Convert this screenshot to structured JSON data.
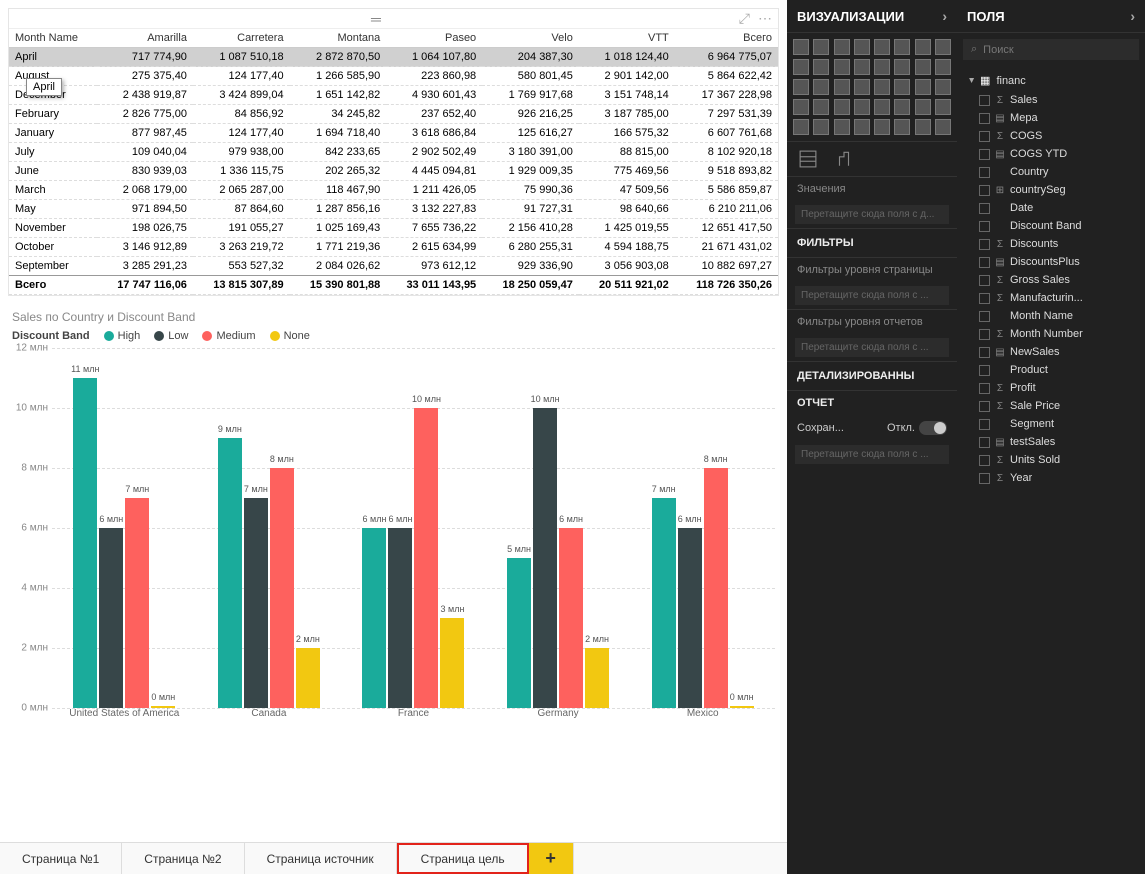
{
  "table": {
    "columns": [
      "Month Name",
      "Amarilla",
      "Carretera",
      "Montana",
      "Paseo",
      "Velo",
      "VTT",
      "Всего"
    ],
    "rows": [
      {
        "highlight": true,
        "cells": [
          "April",
          "717 774,90",
          "1 087 510,18",
          "2 872 870,50",
          "1 064 107,80",
          "204 387,30",
          "1 018 124,40",
          "6 964 775,07"
        ]
      },
      {
        "cells": [
          "August",
          "275 375,40",
          "124 177,40",
          "1 266 585,90",
          "223 860,98",
          "580 801,45",
          "2 901 142,00",
          "5 864 622,42"
        ]
      },
      {
        "cells": [
          "December",
          "2 438 919,87",
          "3 424 899,04",
          "1 651 142,82",
          "4 930 601,43",
          "1 769 917,68",
          "3 151 748,14",
          "17 367 228,98"
        ]
      },
      {
        "cells": [
          "February",
          "2 826 775,00",
          "84 856,92",
          "34 245,82",
          "237 652,40",
          "926 216,25",
          "3 187 785,00",
          "7 297 531,39"
        ]
      },
      {
        "cells": [
          "January",
          "877 987,45",
          "124 177,40",
          "1 694 718,40",
          "3 618 686,84",
          "125 616,27",
          "166 575,32",
          "6 607 761,68"
        ]
      },
      {
        "cells": [
          "July",
          "109 040,04",
          "979 938,00",
          "842 233,65",
          "2 902 502,49",
          "3 180 391,00",
          "88 815,00",
          "8 102 920,18"
        ]
      },
      {
        "cells": [
          "June",
          "830 939,03",
          "1 336 115,75",
          "202 265,32",
          "4 445 094,81",
          "1 929 009,35",
          "775 469,56",
          "9 518 893,82"
        ]
      },
      {
        "cells": [
          "March",
          "2 068 179,00",
          "2 065 287,00",
          "118 467,90",
          "1 211 426,05",
          "75 990,36",
          "47 509,56",
          "5 586 859,87"
        ]
      },
      {
        "cells": [
          "May",
          "971 894,50",
          "87 864,60",
          "1 287 856,16",
          "3 132 227,83",
          "91 727,31",
          "98 640,66",
          "6 210 211,06"
        ]
      },
      {
        "cells": [
          "November",
          "198 026,75",
          "191 055,27",
          "1 025 169,43",
          "7 655 736,22",
          "2 156 410,28",
          "1 425 019,55",
          "12 651 417,50"
        ]
      },
      {
        "cells": [
          "October",
          "3 146 912,89",
          "3 263 219,72",
          "1 771 219,36",
          "2 615 634,99",
          "6 280 255,31",
          "4 594 188,75",
          "21 671 431,02"
        ]
      },
      {
        "cells": [
          "September",
          "3 285 291,23",
          "553 527,32",
          "2 084 026,62",
          "973 612,12",
          "929 336,90",
          "3 056 903,08",
          "10 882 697,27"
        ]
      }
    ],
    "total": {
      "cells": [
        "Всего",
        "17 747 116,06",
        "13 815 307,89",
        "15 390 801,88",
        "33 011 143,95",
        "18 250 059,47",
        "20 511 921,02",
        "118 726 350,26"
      ]
    },
    "tooltip": "April"
  },
  "chart_data": {
    "type": "bar",
    "title": "Sales по Country и Discount Band",
    "legend_label": "Discount Band",
    "ylabel": "",
    "ylim": [
      0,
      12
    ],
    "y_unit": "млн",
    "y_ticks": [
      0,
      2,
      4,
      6,
      8,
      10,
      12
    ],
    "categories": [
      "United States of America",
      "Canada",
      "France",
      "Germany",
      "Mexico"
    ],
    "series": [
      {
        "name": "High",
        "color": "#1aab9b",
        "values": [
          11,
          9,
          6,
          5,
          7
        ]
      },
      {
        "name": "Low",
        "color": "#374649",
        "values": [
          6,
          7,
          6,
          10,
          6
        ]
      },
      {
        "name": "Medium",
        "color": "#fe615e",
        "values": [
          7,
          8,
          10,
          6,
          8
        ]
      },
      {
        "name": "None",
        "color": "#f2c811",
        "values": [
          0,
          2,
          3,
          2,
          0
        ]
      }
    ],
    "bar_labels": [
      [
        "11 млн",
        "6 млн",
        "7 млн",
        "0 млн"
      ],
      [
        "9 млн",
        "7 млн",
        "8 млн",
        "2 млн"
      ],
      [
        "6 млн",
        "6 млн",
        "10 млн",
        "3 млн"
      ],
      [
        "5 млн",
        "10 млн",
        "6 млн",
        "2 млн"
      ],
      [
        "7 млн",
        "6 млн",
        "8 млн",
        "0 млн"
      ]
    ]
  },
  "tabs": [
    "Страница №1",
    "Страница №2",
    "Страница источник",
    "Страница цель"
  ],
  "active_tab_index": 3,
  "viz_panel": {
    "title": "ВИЗУАЛИЗАЦИИ",
    "values_label": "Значения",
    "drop_here": "Перетащите сюда поля с д...",
    "filters_title": "ФИЛЬТРЫ",
    "filter_page": "Фильтры уровня страницы",
    "filter_report": "Фильтры уровня отчетов",
    "drop_fields": "Перетащите сюда поля с ...",
    "drill_title": "ДЕТАЛИЗИРОВАННЫ",
    "report_label": "ОТЧЕТ",
    "keep_label": "Сохран...",
    "off_label": "Откл."
  },
  "fields_panel": {
    "title": "ПОЛЯ",
    "search_placeholder": "Поиск",
    "table_name": "financ",
    "fields": [
      {
        "name": "Sales",
        "sigma": true
      },
      {
        "name": "Мера",
        "sigma": false,
        "icon": "measure"
      },
      {
        "name": "COGS",
        "sigma": true
      },
      {
        "name": "COGS YTD",
        "sigma": false,
        "icon": "measure"
      },
      {
        "name": "Country",
        "sigma": false
      },
      {
        "name": "countrySeg",
        "sigma": false,
        "icon": "hierarchy"
      },
      {
        "name": "Date",
        "sigma": false
      },
      {
        "name": "Discount Band",
        "sigma": false
      },
      {
        "name": "Discounts",
        "sigma": true
      },
      {
        "name": "DiscountsPlus",
        "sigma": false,
        "icon": "measure"
      },
      {
        "name": "Gross Sales",
        "sigma": true
      },
      {
        "name": "Manufacturin...",
        "sigma": true
      },
      {
        "name": "Month Name",
        "sigma": false
      },
      {
        "name": "Month Number",
        "sigma": true
      },
      {
        "name": "NewSales",
        "sigma": false,
        "icon": "measure"
      },
      {
        "name": "Product",
        "sigma": false
      },
      {
        "name": "Profit",
        "sigma": true
      },
      {
        "name": "Sale Price",
        "sigma": true
      },
      {
        "name": "Segment",
        "sigma": false
      },
      {
        "name": "testSales",
        "sigma": false,
        "icon": "measure"
      },
      {
        "name": "Units Sold",
        "sigma": true
      },
      {
        "name": "Year",
        "sigma": true
      }
    ]
  }
}
